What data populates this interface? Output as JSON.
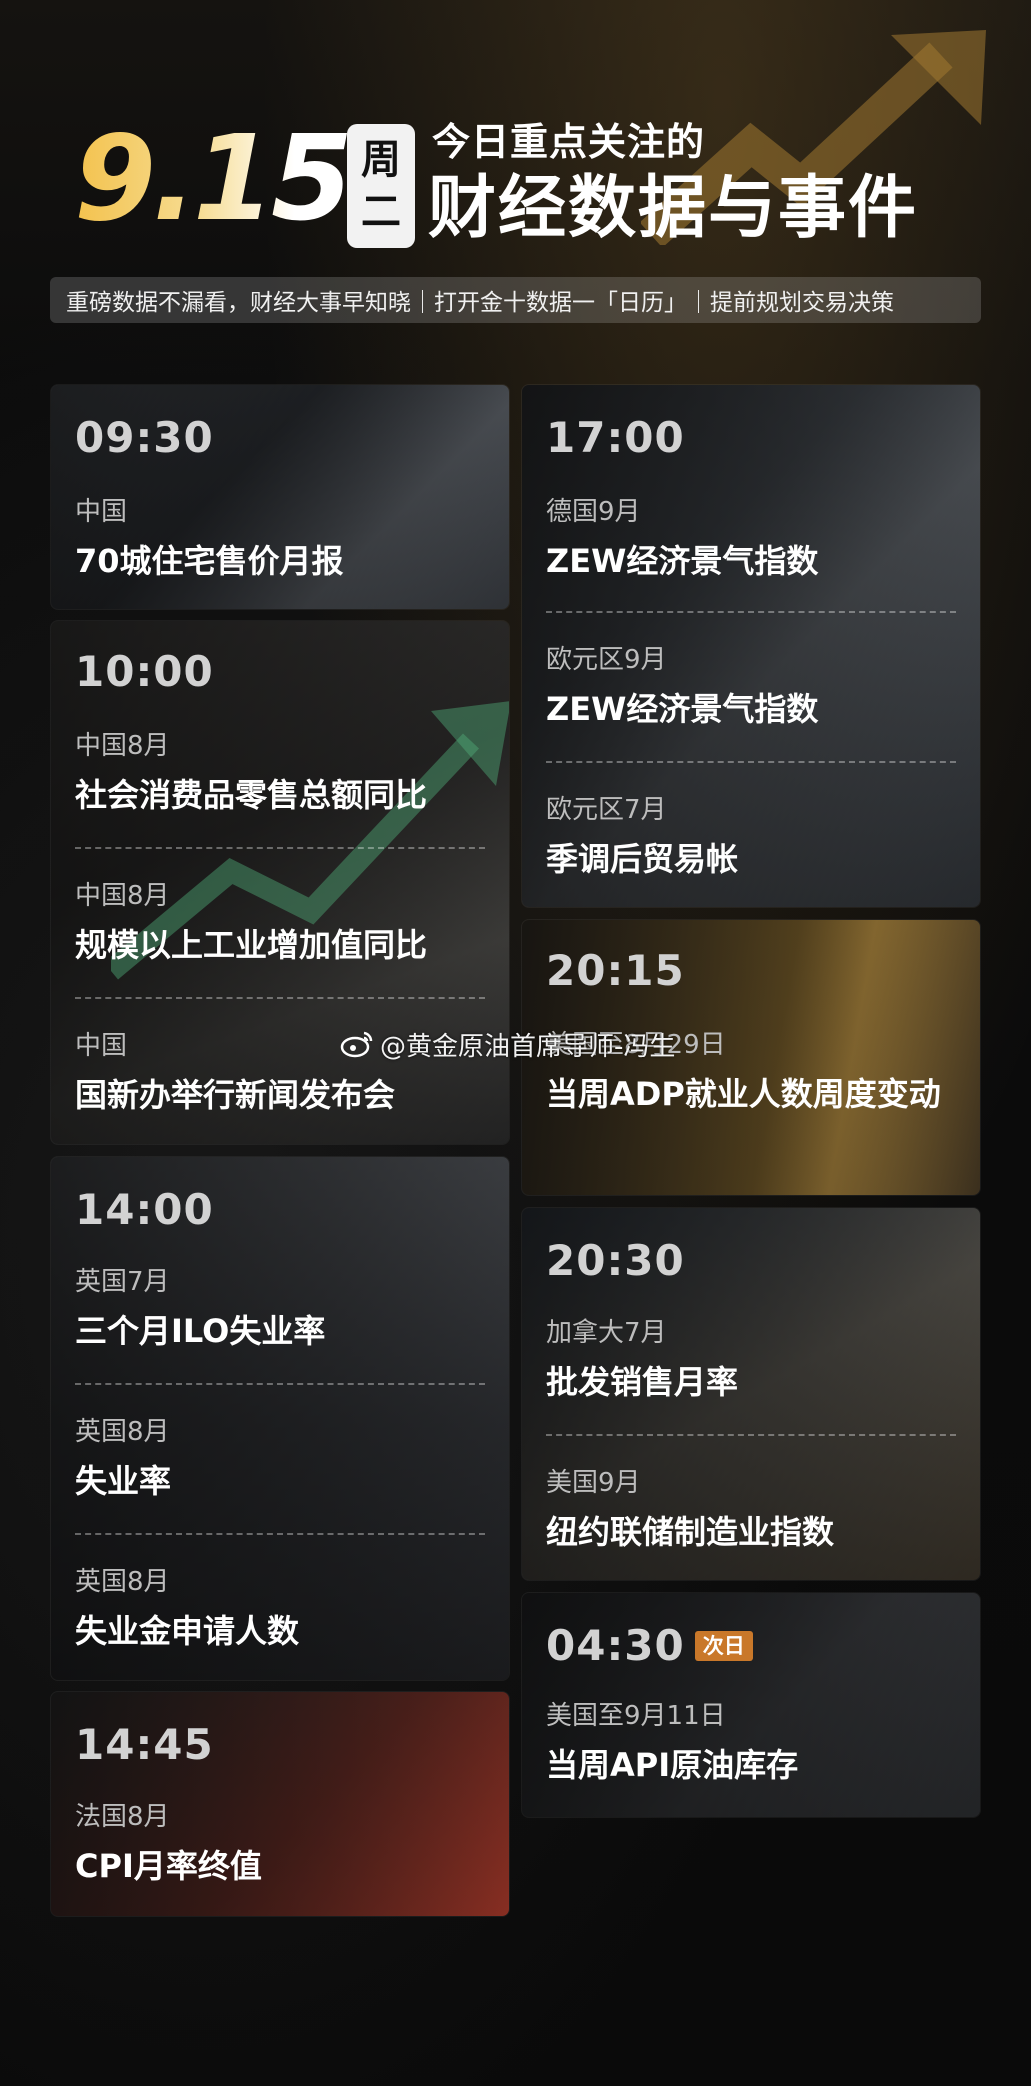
{
  "header": {
    "date": "9.15",
    "weekday_top": "周",
    "weekday_bottom": "二",
    "headline_small": "今日重点关注的",
    "headline_large": "财经数据与事件",
    "subtitle": "重磅数据不漏看，财经大事早知晓｜打开金十数据一「日历」｜提前规划交易决策"
  },
  "left_cards": [
    {
      "time": "09:30",
      "events": [
        {
          "region": "中国",
          "title": "70城住宅售价月报"
        }
      ]
    },
    {
      "time": "10:00",
      "events": [
        {
          "region": "中国8月",
          "title": "社会消费品零售总额同比"
        },
        {
          "region": "中国8月",
          "title": "规模以上工业增加值同比"
        },
        {
          "region": "中国",
          "title": "国新办举行新闻发布会"
        }
      ]
    },
    {
      "time": "14:00",
      "events": [
        {
          "region": "英国7月",
          "title": "三个月ILO失业率"
        },
        {
          "region": "英国8月",
          "title": "失业率"
        },
        {
          "region": "英国8月",
          "title": "失业金申请人数"
        }
      ]
    },
    {
      "time": "14:45",
      "events": [
        {
          "region": "法国8月",
          "title": "CPI月率终值"
        }
      ]
    }
  ],
  "right_cards": [
    {
      "time": "17:00",
      "events": [
        {
          "region": "德国9月",
          "title": "ZEW经济景气指数"
        },
        {
          "region": "欧元区9月",
          "title": "ZEW经济景气指数"
        },
        {
          "region": "欧元区7月",
          "title": "季调后贸易帐"
        }
      ]
    },
    {
      "time": "20:15",
      "events": [
        {
          "region": "美国至8月29日",
          "title": "当周ADP就业人数周度变动"
        }
      ]
    },
    {
      "time": "20:30",
      "events": [
        {
          "region": "加拿大7月",
          "title": "批发销售月率"
        },
        {
          "region": "美国9月",
          "title": "纽约联储制造业指数"
        }
      ]
    },
    {
      "time": "04:30",
      "badge": "次日",
      "events": [
        {
          "region": "美国至9月11日",
          "title": "当周API原油库存"
        }
      ]
    }
  ],
  "watermark": "@黄金原油首席导师-冯生",
  "colors": {
    "gold": "#f3c24d",
    "badge": "#c9782a"
  }
}
